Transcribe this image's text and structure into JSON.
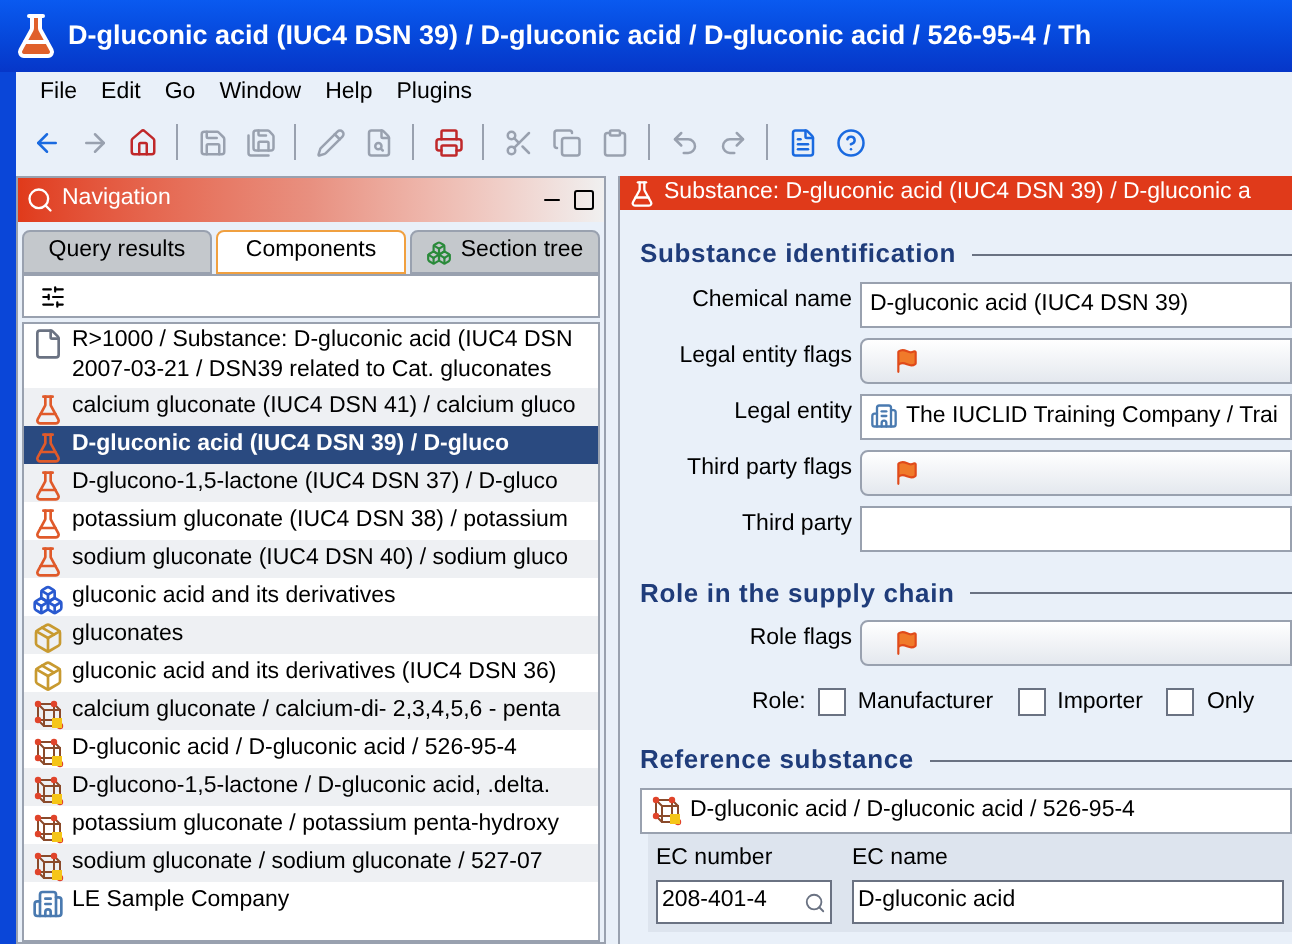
{
  "window": {
    "title": "D-gluconic acid (IUC4 DSN 39) / D-gluconic acid / D-gluconic acid / 526-95-4 / Th"
  },
  "menu": [
    "File",
    "Edit",
    "Go",
    "Window",
    "Help",
    "Plugins"
  ],
  "toolbar": [
    {
      "kind": "back",
      "disabled": false
    },
    {
      "kind": "forward",
      "disabled": true
    },
    {
      "kind": "home",
      "disabled": false
    },
    {
      "kind": "sep"
    },
    {
      "kind": "save",
      "disabled": true
    },
    {
      "kind": "saveall",
      "disabled": true
    },
    {
      "kind": "sep"
    },
    {
      "kind": "edit",
      "disabled": true
    },
    {
      "kind": "preview",
      "disabled": true
    },
    {
      "kind": "sep"
    },
    {
      "kind": "print",
      "disabled": false
    },
    {
      "kind": "sep"
    },
    {
      "kind": "cut",
      "disabled": true
    },
    {
      "kind": "copy",
      "disabled": true
    },
    {
      "kind": "paste",
      "disabled": true
    },
    {
      "kind": "sep"
    },
    {
      "kind": "undo",
      "disabled": true
    },
    {
      "kind": "redo",
      "disabled": true
    },
    {
      "kind": "sep"
    },
    {
      "kind": "info",
      "disabled": false
    },
    {
      "kind": "help",
      "disabled": false
    }
  ],
  "navigation": {
    "title": "Navigation",
    "tabs": [
      {
        "label": "Query results",
        "selected": false
      },
      {
        "label": "Components",
        "selected": true
      },
      {
        "label": "Section tree",
        "selected": false
      }
    ],
    "items": [
      {
        "kind": "document",
        "lines": [
          "R>1000 / Substance: D-gluconic acid (IUC4 DSN",
          "2007-03-21 / DSN39 related to Cat. gluconates"
        ],
        "selected": false
      },
      {
        "kind": "flask",
        "lines": [
          "calcium gluconate (IUC4 DSN 41) / calcium gluco"
        ],
        "selected": false
      },
      {
        "kind": "flask",
        "lines": [
          "D-gluconic acid (IUC4 DSN 39) / D-gluco"
        ],
        "selected": true
      },
      {
        "kind": "flask",
        "lines": [
          "D-glucono-1,5-lactone (IUC4 DSN 37) / D-gluco"
        ],
        "selected": false
      },
      {
        "kind": "flask",
        "lines": [
          "potassium gluconate (IUC4 DSN 38) / potassium"
        ],
        "selected": false
      },
      {
        "kind": "flask",
        "lines": [
          "sodium gluconate (IUC4 DSN 40) / sodium gluco"
        ],
        "selected": false
      },
      {
        "kind": "group",
        "lines": [
          "gluconic acid and its derivatives"
        ],
        "selected": false
      },
      {
        "kind": "category",
        "lines": [
          "gluconates"
        ],
        "selected": false
      },
      {
        "kind": "category",
        "lines": [
          "gluconic acid and its derivatives (IUC4 DSN 36)"
        ],
        "selected": false
      },
      {
        "kind": "molecule",
        "lines": [
          "calcium gluconate / calcium-di- 2,3,4,5,6 - penta"
        ],
        "selected": false
      },
      {
        "kind": "molecule",
        "lines": [
          "D-gluconic acid / D-gluconic acid / 526-95-4"
        ],
        "selected": false
      },
      {
        "kind": "molecule",
        "lines": [
          "D-glucono-1,5-lactone / D-gluconic acid, .delta."
        ],
        "selected": false
      },
      {
        "kind": "molecule",
        "lines": [
          "potassium gluconate / potassium penta-hydroxy"
        ],
        "selected": false
      },
      {
        "kind": "molecule",
        "lines": [
          "sodium gluconate / sodium gluconate / 527-07"
        ],
        "selected": false
      },
      {
        "kind": "company",
        "lines": [
          "LE Sample Company"
        ],
        "selected": false
      }
    ]
  },
  "editor": {
    "title": "Substance: D-gluconic acid (IUC4 DSN 39) / D-gluconic a",
    "sections": [
      {
        "heading": "Substance identification",
        "fields": [
          {
            "kind": "text",
            "label": "Chemical name",
            "value": "D-gluconic acid (IUC4 DSN 39)"
          },
          {
            "kind": "flags",
            "label": "Legal entity flags"
          },
          {
            "kind": "entity",
            "label": "Legal entity",
            "value": "The IUCLID Training Company / Trai"
          },
          {
            "kind": "flags",
            "label": "Third party flags"
          },
          {
            "kind": "text",
            "label": "Third party"
          }
        ]
      },
      {
        "heading": "Role in the supply chain",
        "fields": [
          {
            "kind": "flags",
            "label": "Role flags"
          }
        ],
        "role": {
          "label": "Role:",
          "options": [
            {
              "label": "Manufacturer",
              "checked": false
            },
            {
              "label": "Importer",
              "checked": false
            },
            {
              "label": "Only",
              "checked": false
            }
          ]
        }
      },
      {
        "heading": "Reference substance",
        "reference": {
          "value": "D-gluconic acid / D-gluconic acid / 526-95-4",
          "ec_number_label": "EC number",
          "ec_number": "208-401-4",
          "ec_name_label": "EC name",
          "ec_name": "D-gluconic acid"
        }
      }
    ]
  }
}
